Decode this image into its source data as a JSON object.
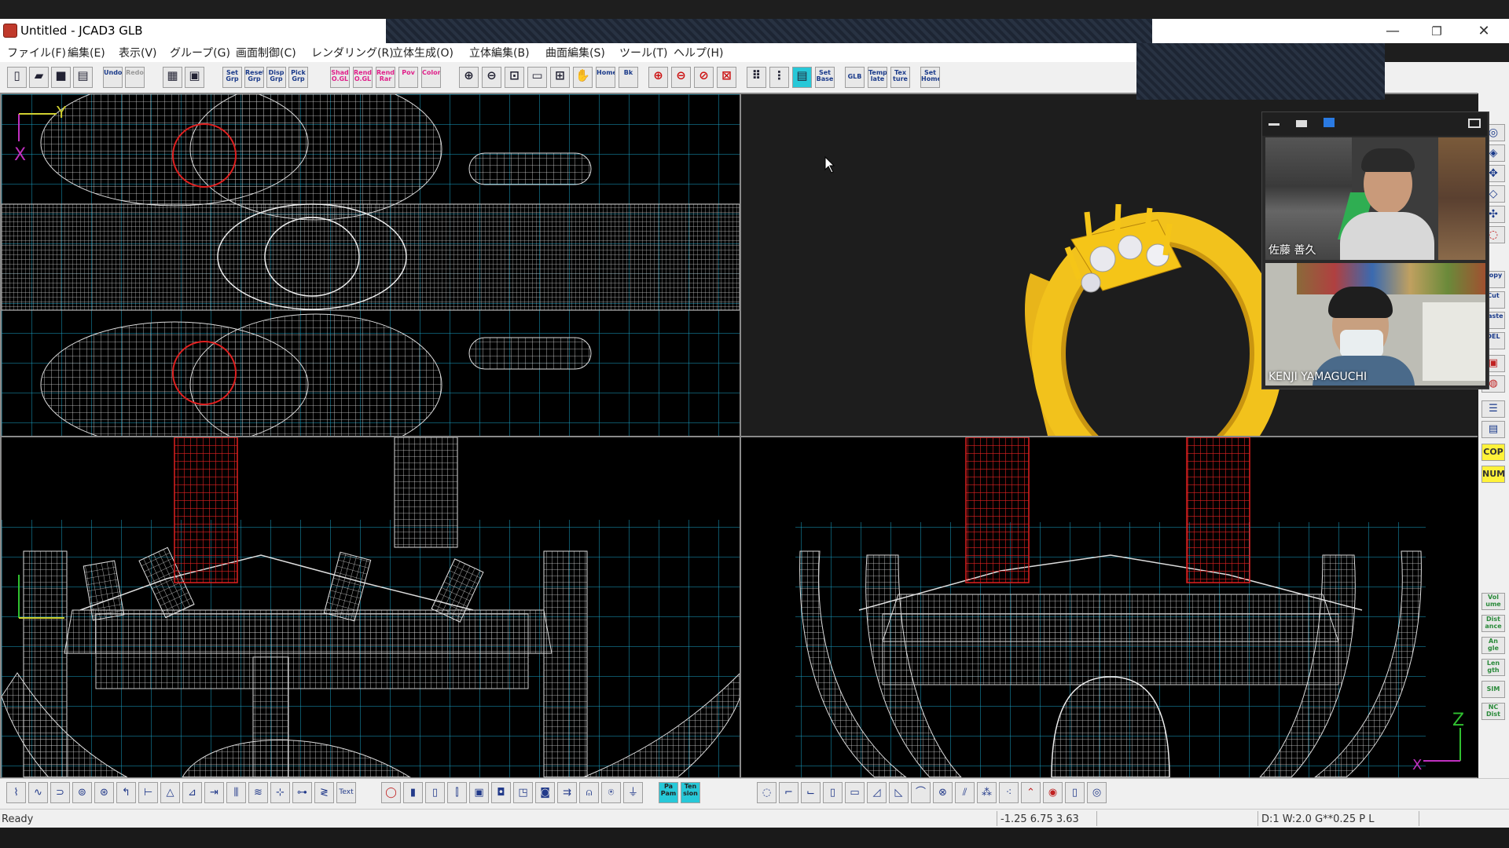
{
  "window": {
    "title": "Untitled - JCAD3 GLB",
    "controls": {
      "minimize": "—",
      "restore": "❐",
      "close": "✕"
    }
  },
  "menu": [
    "ファイル(F)",
    "編集(E)",
    "表示(V)",
    "グループ(G)",
    "画面制御(C)",
    "レンダリング(R)",
    "立体生成(O)",
    "立体編集(B)",
    "曲面編集(S)",
    "ツール(T)",
    "ヘルプ(H)"
  ],
  "top_toolbar": {
    "group1": [
      "new-icon",
      "open-icon",
      "save-icon",
      "print-icon"
    ],
    "undo": "Undo",
    "redo": "Redo",
    "grp_buttons": [
      "Set Grp",
      "Reset Grp",
      "Disp Grp",
      "Pick Grp"
    ],
    "render_buttons": [
      "Shad O.GL",
      "Rend O.GL",
      "Rend Rar",
      "Pov",
      "Color"
    ],
    "view_labels": [
      "Home",
      "Bk"
    ],
    "set_base": "Set Base",
    "glb": "GLB",
    "template": "Temp late",
    "texture": "Tex ture",
    "set_home": "Set Home"
  },
  "right_toolbar": {
    "edit_labels": [
      "Copy",
      "Cut",
      "Paste",
      "DEL"
    ],
    "cop": "COP",
    "num": "NUM",
    "measure_labels": [
      "Vol ume",
      "Dist ance",
      "An gle",
      "Len gth",
      "SIM",
      "NC Dist"
    ]
  },
  "bottom_toolbar": {
    "text_tool": "Text",
    "cyan_buttons": [
      "Pa Pam",
      "Ten sion"
    ]
  },
  "statusbar": {
    "status": "Ready",
    "coordinates": "-1.25 6.75 3.63",
    "display": "D:1 W:2.0  G**0.25 P   L"
  },
  "viewports": {
    "top_axes": {
      "x": "X",
      "y": "Y"
    },
    "front_axes": {
      "z": "Z",
      "x": "X"
    }
  },
  "video_call": {
    "participants": [
      {
        "name": "佐藤 善久"
      },
      {
        "name": "KENJI YAMAGUCHI"
      }
    ]
  },
  "colors": {
    "grid": "#1aa3c8",
    "wire": "#d8d8d8",
    "gem_setting": "#e02020",
    "ring_gold": "#f2c21c",
    "cop_yellow": "#fff23a",
    "cyan_tool": "#27c8d8"
  }
}
